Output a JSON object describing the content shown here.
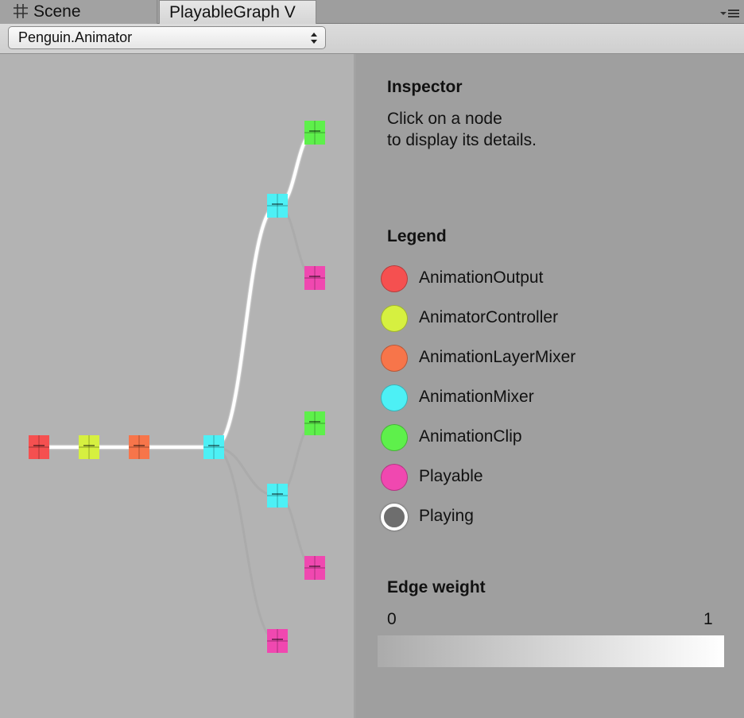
{
  "tabs": [
    {
      "label": "Scene",
      "icon": "grid-icon"
    },
    {
      "label": "PlayableGraph V",
      "active": true
    }
  ],
  "toolbar": {
    "selected_graph": "Penguin.Animator"
  },
  "inspector": {
    "title": "Inspector",
    "hint_line1": "Click on a node",
    "hint_line2": "to display its details."
  },
  "legend": {
    "title": "Legend",
    "items": [
      {
        "label": "AnimationOutput",
        "color": "#f55050"
      },
      {
        "label": "AnimatorController",
        "color": "#d6f040"
      },
      {
        "label": "AnimationLayerMixer",
        "color": "#f7754a"
      },
      {
        "label": "AnimationMixer",
        "color": "#4df0f5"
      },
      {
        "label": "AnimationClip",
        "color": "#5ef04b"
      },
      {
        "label": "Playable",
        "color": "#f048b0"
      },
      {
        "label": "Playing",
        "color": "#6e6e6e"
      }
    ]
  },
  "edge_weight": {
    "title": "Edge weight",
    "min_label": "0",
    "max_label": "1"
  },
  "graph": {
    "nodes": [
      {
        "id": "n1",
        "type": "AnimationOutput",
        "color": "#f55050"
      },
      {
        "id": "n2",
        "type": "AnimatorController",
        "color": "#d6f040"
      },
      {
        "id": "n3",
        "type": "AnimationLayerMixer",
        "color": "#f7754a"
      },
      {
        "id": "n4",
        "type": "AnimationMixer",
        "color": "#4df0f5"
      },
      {
        "id": "n5",
        "type": "AnimationMixer",
        "color": "#4df0f5"
      },
      {
        "id": "n6",
        "type": "AnimationClip",
        "color": "#5ef04b"
      },
      {
        "id": "n7",
        "type": "Playable",
        "color": "#f048b0"
      },
      {
        "id": "n8",
        "type": "AnimationMixer",
        "color": "#4df0f5"
      },
      {
        "id": "n9",
        "type": "AnimationClip",
        "color": "#5ef04b"
      },
      {
        "id": "n10",
        "type": "Playable",
        "color": "#f048b0"
      },
      {
        "id": "n11",
        "type": "Playable",
        "color": "#f048b0"
      }
    ],
    "edges": [
      {
        "from": "n2",
        "to": "n1",
        "weight": 1
      },
      {
        "from": "n3",
        "to": "n2",
        "weight": 1
      },
      {
        "from": "n4",
        "to": "n3",
        "weight": 1
      },
      {
        "from": "n5",
        "to": "n4",
        "weight": 1
      },
      {
        "from": "n6",
        "to": "n5",
        "weight": 1
      },
      {
        "from": "n7",
        "to": "n5",
        "weight": 0
      },
      {
        "from": "n8",
        "to": "n4",
        "weight": 0
      },
      {
        "from": "n9",
        "to": "n8",
        "weight": 0
      },
      {
        "from": "n10",
        "to": "n8",
        "weight": 0
      },
      {
        "from": "n11",
        "to": "n4",
        "weight": 0
      }
    ]
  }
}
